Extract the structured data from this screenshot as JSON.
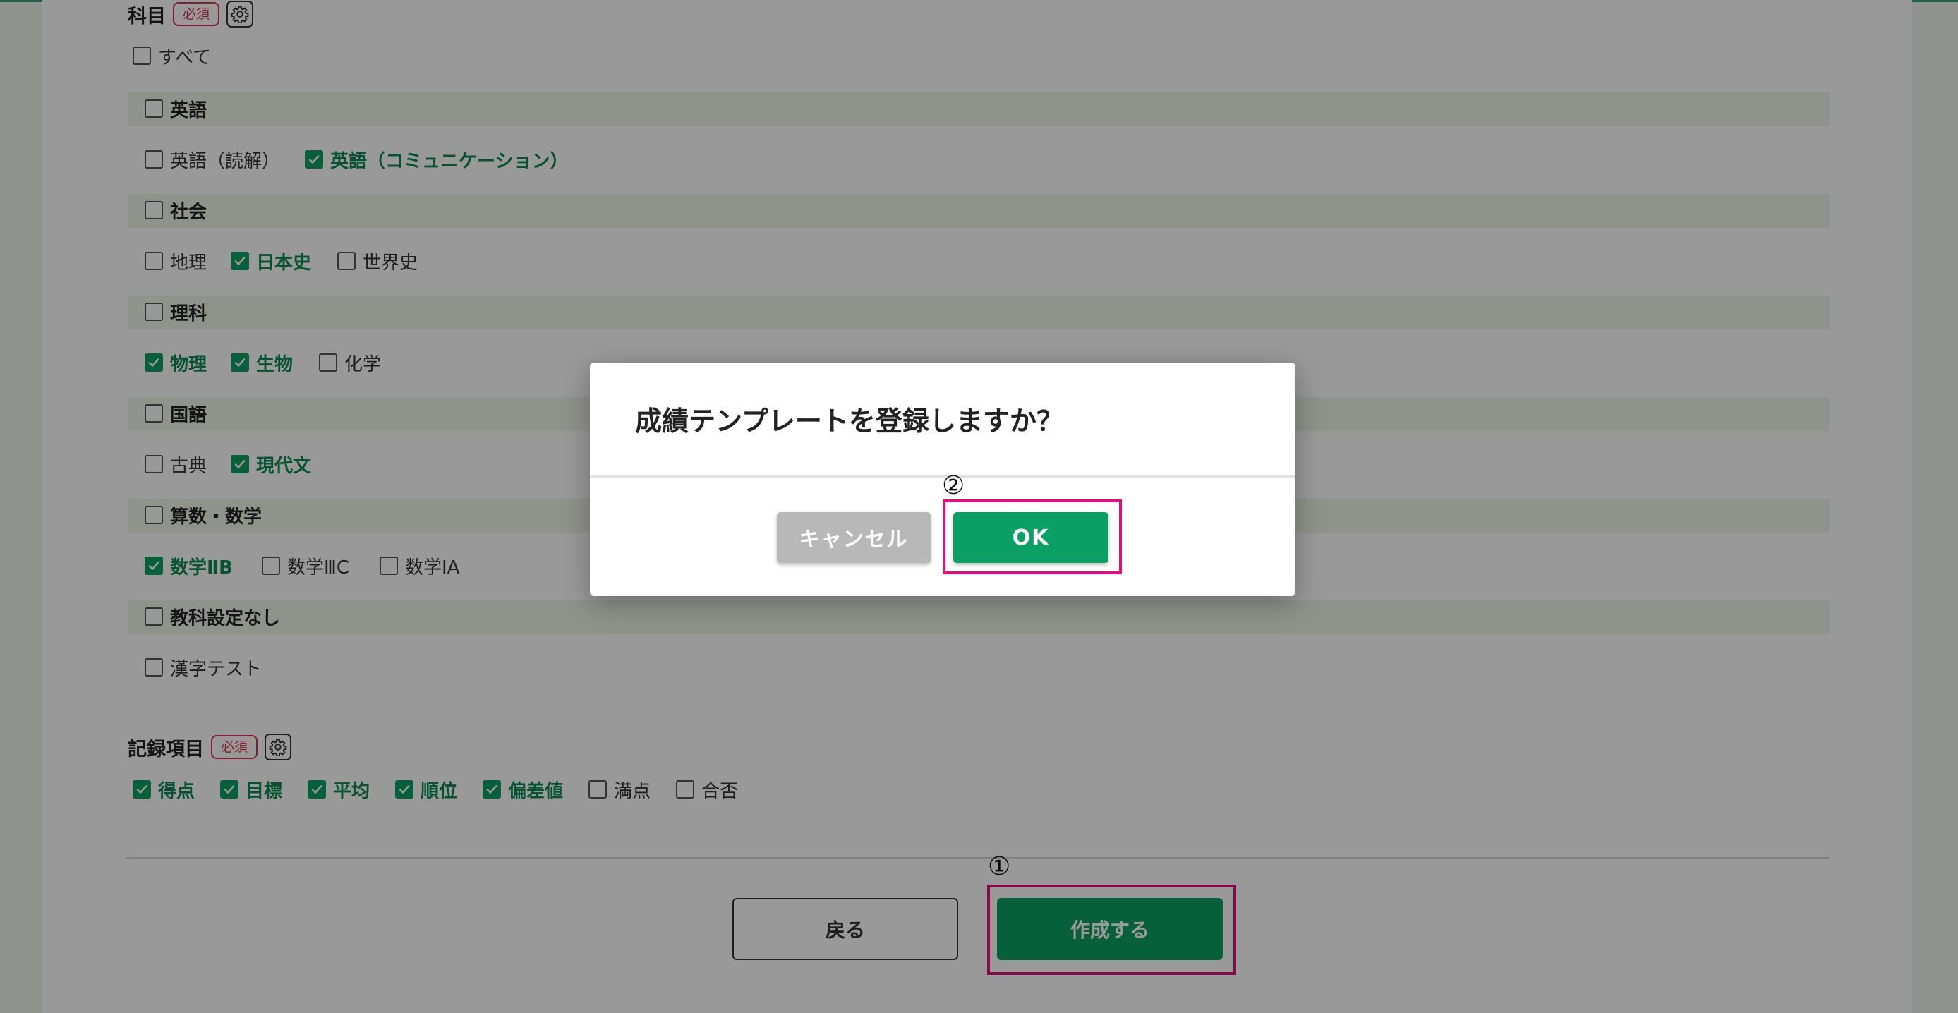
{
  "subjects": {
    "title": "科目",
    "required_badge": "必須",
    "all_label": "すべて",
    "groups": [
      {
        "label": "英語",
        "items": [
          {
            "label": "英語（読解）",
            "checked": false
          },
          {
            "label": "英語（コミュニケーション）",
            "checked": true
          }
        ]
      },
      {
        "label": "社会",
        "items": [
          {
            "label": "地理",
            "checked": false
          },
          {
            "label": "日本史",
            "checked": true
          },
          {
            "label": "世界史",
            "checked": false
          }
        ]
      },
      {
        "label": "理科",
        "items": [
          {
            "label": "物理",
            "checked": true
          },
          {
            "label": "生物",
            "checked": true
          },
          {
            "label": "化学",
            "checked": false
          }
        ]
      },
      {
        "label": "国語",
        "items": [
          {
            "label": "古典",
            "checked": false
          },
          {
            "label": "現代文",
            "checked": true
          }
        ]
      },
      {
        "label": "算数・数学",
        "items": [
          {
            "label": "数学ⅡB",
            "checked": true
          },
          {
            "label": "数学ⅢC",
            "checked": false
          },
          {
            "label": "数学ⅠA",
            "checked": false
          }
        ]
      },
      {
        "label": "教科設定なし",
        "items": [
          {
            "label": "漢字テスト",
            "checked": false
          }
        ]
      }
    ]
  },
  "record_items": {
    "title": "記録項目",
    "required_badge": "必須",
    "items": [
      {
        "label": "得点",
        "checked": true
      },
      {
        "label": "目標",
        "checked": true
      },
      {
        "label": "平均",
        "checked": true
      },
      {
        "label": "順位",
        "checked": true
      },
      {
        "label": "偏差値",
        "checked": true
      },
      {
        "label": "満点",
        "checked": false
      },
      {
        "label": "合否",
        "checked": false
      }
    ]
  },
  "footer": {
    "back_label": "戻る",
    "create_label": "作成する"
  },
  "annotations": {
    "step1": "①",
    "step2": "②"
  },
  "dialog": {
    "title": "成績テンプレートを登録しますか？",
    "cancel_label": "キャンセル",
    "ok_label": "OK"
  },
  "colors": {
    "accent": "#0aa065",
    "required": "#d9344f",
    "highlight": "#e0107a"
  }
}
